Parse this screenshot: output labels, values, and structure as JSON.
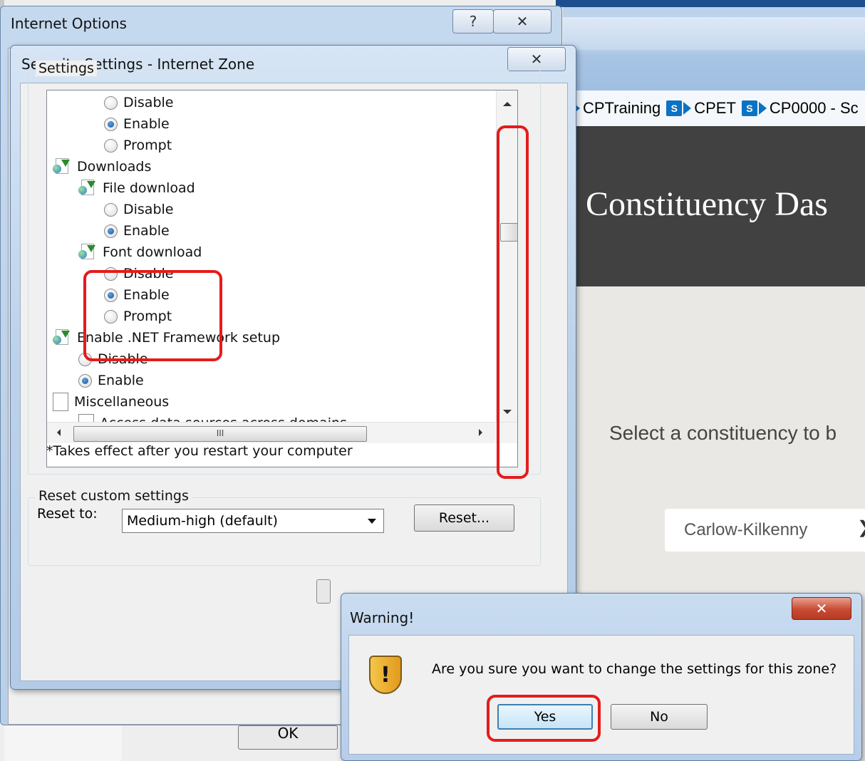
{
  "browser": {
    "favorites": [
      {
        "label": "CPTraining",
        "icon": "sharepoint-icon"
      },
      {
        "label": "CPET",
        "icon": "sharepoint-icon"
      },
      {
        "label": "CP0000 - Sc",
        "icon": "sharepoint-icon"
      }
    ],
    "page_title": "Constituency Das",
    "select_prompt": "Select a constituency to b",
    "constituency_value": "Carlow-Kilkenny",
    "chevron_glyph": "❯"
  },
  "internet_options": {
    "title": "Internet Options",
    "help_glyph": "?",
    "close_glyph": "✕",
    "ok_label": "OK"
  },
  "security_settings": {
    "title": "Security Settings - Internet Zone",
    "close_glyph": "✕",
    "settings_group_label": "Settings",
    "tree": [
      {
        "type": "radio",
        "label": "Disable",
        "checked": false,
        "indent": 2
      },
      {
        "type": "radio",
        "label": "Enable",
        "checked": true,
        "indent": 2
      },
      {
        "type": "radio",
        "label": "Prompt",
        "checked": false,
        "indent": 2
      },
      {
        "type": "category",
        "label": "Downloads",
        "icon": "setting-icon",
        "indent": 0
      },
      {
        "type": "category",
        "label": "File download",
        "icon": "setting-icon",
        "indent": 1
      },
      {
        "type": "radio",
        "label": "Disable",
        "checked": false,
        "indent": 2
      },
      {
        "type": "radio",
        "label": "Enable",
        "checked": true,
        "indent": 2
      },
      {
        "type": "category",
        "label": "Font download",
        "icon": "setting-icon",
        "indent": 1
      },
      {
        "type": "radio",
        "label": "Disable",
        "checked": false,
        "indent": 2
      },
      {
        "type": "radio",
        "label": "Enable",
        "checked": true,
        "indent": 2
      },
      {
        "type": "radio",
        "label": "Prompt",
        "checked": false,
        "indent": 2
      },
      {
        "type": "category",
        "label": "Enable .NET Framework setup",
        "icon": "setting-icon",
        "indent": 0
      },
      {
        "type": "radio",
        "label": "Disable",
        "checked": false,
        "indent": 1
      },
      {
        "type": "radio",
        "label": "Enable",
        "checked": true,
        "indent": 1
      },
      {
        "type": "category",
        "label": "Miscellaneous",
        "icon": "document-icon",
        "indent": 0
      },
      {
        "type": "category",
        "label": "Access data sources across domains",
        "icon": "document-icon",
        "indent": 1
      }
    ],
    "hscroll_grip": "III",
    "note": "*Takes effect after you restart your computer",
    "reset_group_label": "Reset custom settings",
    "reset_to_label": "Reset to:",
    "reset_level": "Medium-high (default)",
    "reset_button": "Reset..."
  },
  "warning": {
    "title": "Warning!",
    "close_glyph": "✕",
    "icon": "warning-shield-icon",
    "message": "Are you sure you want to change the settings for this zone?",
    "yes_label": "Yes",
    "no_label": "No"
  },
  "highlight_color": "#e31c1c"
}
